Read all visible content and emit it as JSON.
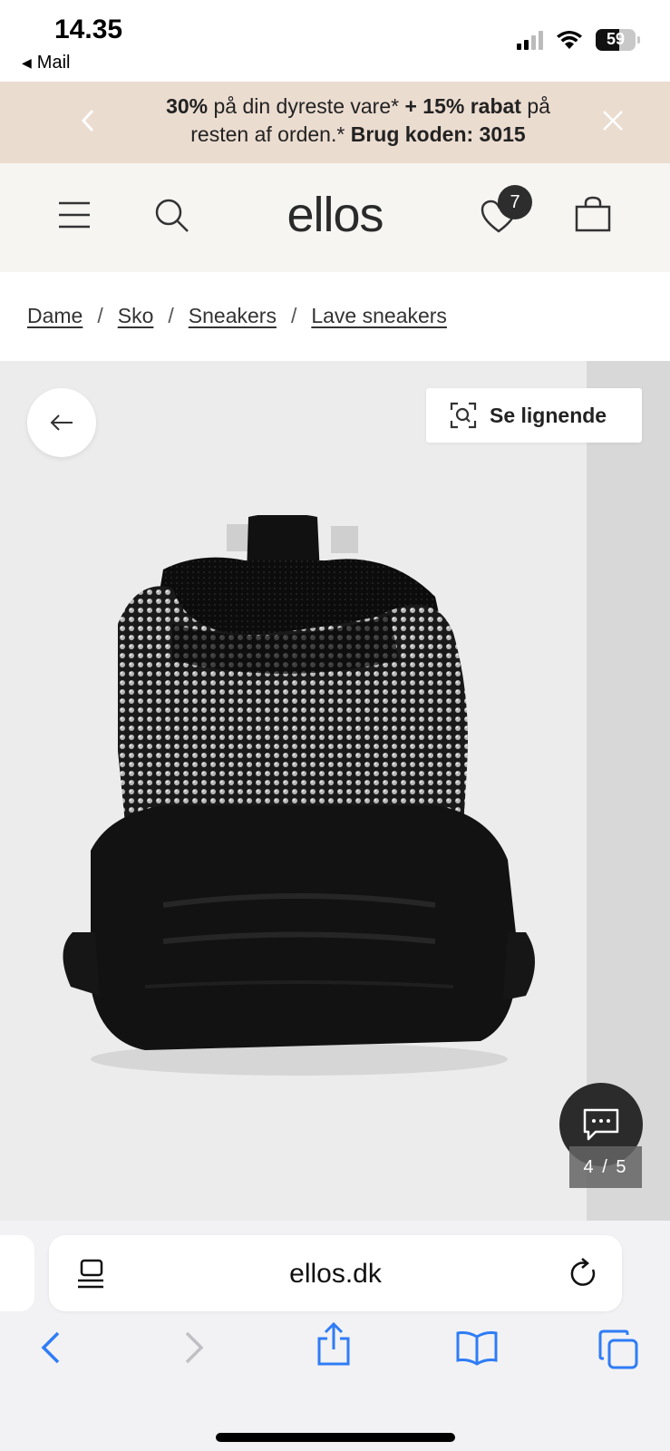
{
  "status_bar": {
    "time": "14.35",
    "back_app": "Mail",
    "battery": "59"
  },
  "promo": {
    "line1_bold_a": "30%",
    "line1_mid": " på din dyreste vare* ",
    "line1_bold_b": "+ 15% rabat",
    "line1_end": " på",
    "line2_start": "resten af orden.* ",
    "line2_bold": "Brug koden: 3015"
  },
  "header": {
    "logo": "ellos",
    "wishlist_count": "7"
  },
  "breadcrumb": {
    "items": [
      "Dame",
      "Sko",
      "Sneakers",
      "Lave sneakers"
    ],
    "separator": "/"
  },
  "gallery": {
    "similar_label": "Se lignende",
    "counter": "4 / 5"
  },
  "browser": {
    "url": "ellos.dk"
  },
  "colors": {
    "promo_bg": "#ebdcd0",
    "header_bg": "#f7f5f2",
    "ios_blue": "#2f7cf6"
  }
}
